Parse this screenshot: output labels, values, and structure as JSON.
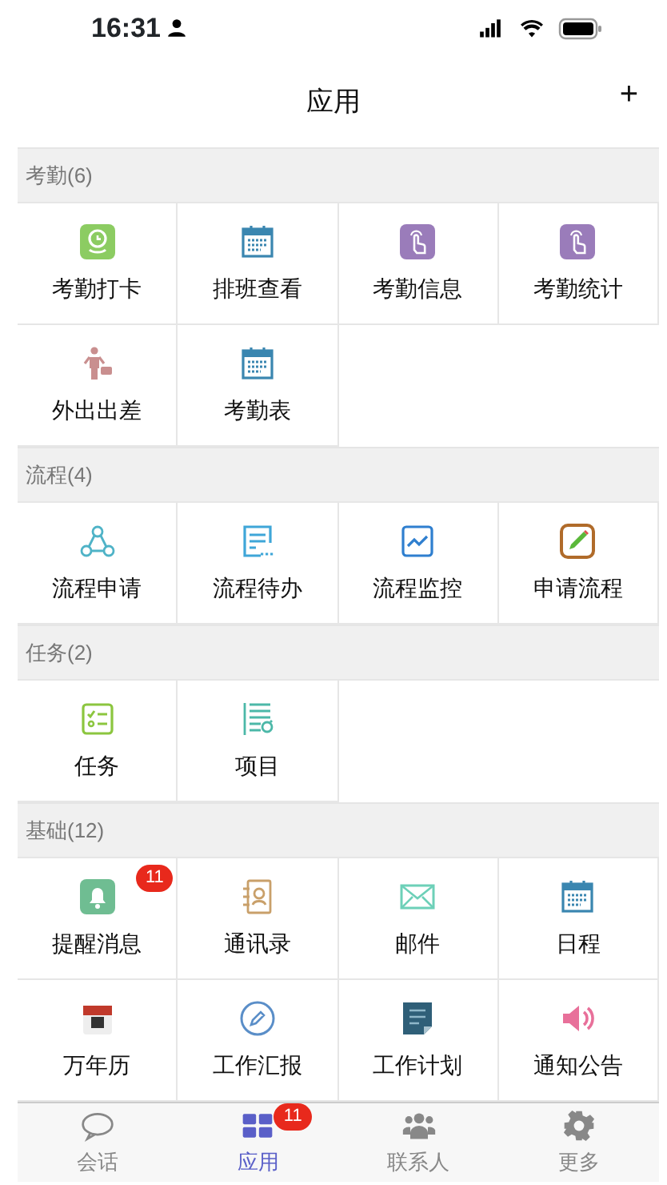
{
  "status_bar": {
    "time": "16:31"
  },
  "header": {
    "title": "应用",
    "action": "+"
  },
  "sections": [
    {
      "title": "考勤(6)",
      "items": [
        {
          "label": "考勤打卡"
        },
        {
          "label": "排班查看"
        },
        {
          "label": "考勤信息"
        },
        {
          "label": "考勤统计"
        },
        {
          "label": "外出出差"
        },
        {
          "label": "考勤表"
        }
      ]
    },
    {
      "title": "流程(4)",
      "items": [
        {
          "label": "流程申请"
        },
        {
          "label": "流程待办"
        },
        {
          "label": "流程监控"
        },
        {
          "label": "申请流程"
        }
      ]
    },
    {
      "title": "任务(2)",
      "items": [
        {
          "label": "任务"
        },
        {
          "label": "项目"
        }
      ]
    },
    {
      "title": "基础(12)",
      "items": [
        {
          "label": "提醒消息",
          "badge": "11"
        },
        {
          "label": "通讯录"
        },
        {
          "label": "邮件"
        },
        {
          "label": "日程"
        },
        {
          "label": "万年历"
        },
        {
          "label": "工作汇报"
        },
        {
          "label": "工作计划"
        },
        {
          "label": "通知公告"
        }
      ]
    }
  ],
  "tab_bar": [
    {
      "label": "会话",
      "selected": false
    },
    {
      "label": "应用",
      "selected": true,
      "badge": "11"
    },
    {
      "label": "联系人",
      "selected": false
    },
    {
      "label": "更多",
      "selected": false
    }
  ]
}
